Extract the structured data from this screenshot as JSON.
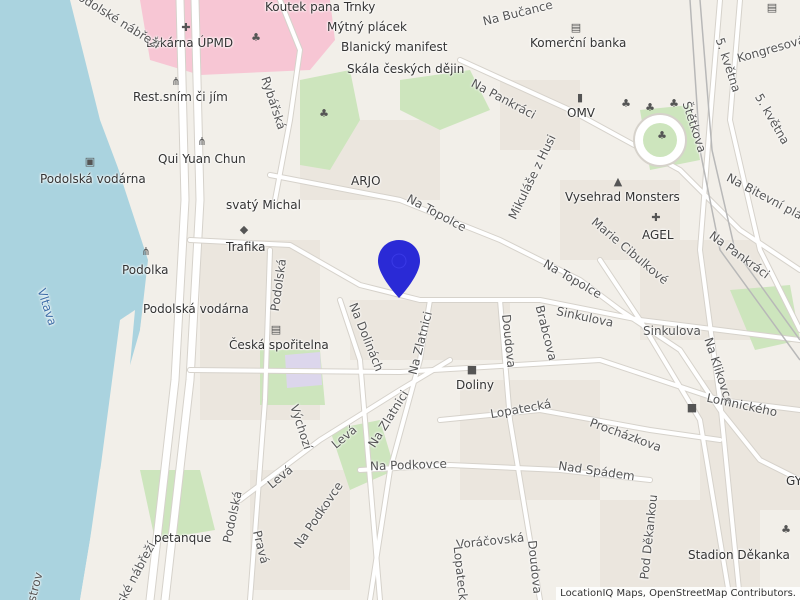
{
  "map": {
    "place_labels": [
      {
        "key": "koutek",
        "text": "Koutek pana Trnky"
      },
      {
        "key": "mytny",
        "text": "Mýtný plácek"
      },
      {
        "key": "blanicky",
        "text": "Blanický manifest"
      },
      {
        "key": "skala",
        "text": "Skála českých dějin"
      },
      {
        "key": "lekarna",
        "text": "Lékárna ÚPMD"
      },
      {
        "key": "komercni",
        "text": "Komerční banka"
      },
      {
        "key": "omv",
        "text": "OMV"
      },
      {
        "key": "restsnim",
        "text": "Rest.sním či jím"
      },
      {
        "key": "quiyuan",
        "text": "Qui Yuan Chun"
      },
      {
        "key": "podolska_vodarna1",
        "text": "Podolská vodárna"
      },
      {
        "key": "arjo",
        "text": "ARJO"
      },
      {
        "key": "vysehrad",
        "text": "Vysehrad Monsters"
      },
      {
        "key": "svatymichal",
        "text": "svatý Michal"
      },
      {
        "key": "agel",
        "text": "AGEL"
      },
      {
        "key": "trafika",
        "text": "Trafika"
      },
      {
        "key": "podolka",
        "text": "Podolka"
      },
      {
        "key": "podolska_vodarna2",
        "text": "Podolská vodárna"
      },
      {
        "key": "ceska",
        "text": "Česká spořitelna"
      },
      {
        "key": "doliny",
        "text": "Doliny"
      },
      {
        "key": "petanque",
        "text": "petanque"
      },
      {
        "key": "stadion",
        "text": "Stadion Děkanka"
      },
      {
        "key": "gy",
        "text": "GY"
      }
    ],
    "street_labels": [
      {
        "key": "nabucance",
        "text": "Na Bučance"
      },
      {
        "key": "podolske",
        "text": "Podolské nábřeží"
      },
      {
        "key": "kongresova",
        "text": "Kongresová"
      },
      {
        "key": "skvetna1",
        "text": "5. května"
      },
      {
        "key": "skvetna2",
        "text": "5. května"
      },
      {
        "key": "napankraci1",
        "text": "Na Pankráci"
      },
      {
        "key": "rybarska",
        "text": "Rybářská"
      },
      {
        "key": "stetkova",
        "text": "Štětkova"
      },
      {
        "key": "mikulase",
        "text": "Mikuláše z Husi"
      },
      {
        "key": "natopolce1",
        "text": "Na Topolce"
      },
      {
        "key": "nabitevni",
        "text": "Na Bitevní pláni"
      },
      {
        "key": "mariecibulkove",
        "text": "Marie Cibulkové"
      },
      {
        "key": "napankraci2",
        "text": "Na Pankráci"
      },
      {
        "key": "natopolce2",
        "text": "Na Topolce"
      },
      {
        "key": "podolska1",
        "text": "Podolská"
      },
      {
        "key": "sinkulova1",
        "text": "Sinkulova"
      },
      {
        "key": "sinkulova2",
        "text": "Sinkulova"
      },
      {
        "key": "nadolinach",
        "text": "Na Dolinách"
      },
      {
        "key": "nazlatnici1",
        "text": "Na Zlatnici"
      },
      {
        "key": "doudova1",
        "text": "Doudova"
      },
      {
        "key": "brabcova",
        "text": "Brabcova"
      },
      {
        "key": "naklikovce",
        "text": "Na Klikovce"
      },
      {
        "key": "lopatecka1",
        "text": "Lopatecká"
      },
      {
        "key": "lomnickeho",
        "text": "Lomnického"
      },
      {
        "key": "vychozi",
        "text": "Výchozí"
      },
      {
        "key": "leva1",
        "text": "Levá"
      },
      {
        "key": "leva2",
        "text": "Levá"
      },
      {
        "key": "nazlatnici2",
        "text": "Na Zlatnici"
      },
      {
        "key": "prochazkova",
        "text": "Procházkova"
      },
      {
        "key": "napodkovce1",
        "text": "Na Podkovce"
      },
      {
        "key": "nadspadem",
        "text": "Nad Spádem"
      },
      {
        "key": "podolska2",
        "text": "Podolská"
      },
      {
        "key": "napodkovce2",
        "text": "Na Podkovce"
      },
      {
        "key": "voracovska",
        "text": "Voráčovská"
      },
      {
        "key": "doudova2",
        "text": "Doudova"
      },
      {
        "key": "podekankou",
        "text": "Pod Děkankou"
      },
      {
        "key": "prava",
        "text": "Pravá"
      },
      {
        "key": "lopatecka2",
        "text": "Lopatecká"
      },
      {
        "key": "podolske2",
        "text": "ské nábřeží"
      },
      {
        "key": "ostrov",
        "text": "strov"
      }
    ],
    "water_labels": [
      {
        "key": "vltava",
        "text": "Vltava"
      }
    ],
    "marker": {
      "name": "location-pin",
      "color": "#2a2ad6"
    },
    "attribution": "LocationIQ Maps, OpenStreetMap Contributors."
  },
  "colors": {
    "water": "#aad3df",
    "river_label": "#3f6fa8",
    "land": "#f2efe9",
    "park": "#cde5bd",
    "hospital": "#f7c6d4",
    "road": "#ffffff",
    "road_casing": "#d6d2cb"
  }
}
